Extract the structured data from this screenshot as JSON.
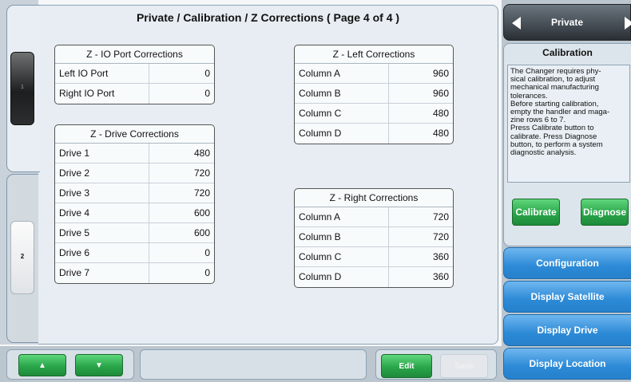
{
  "page": {
    "title": "Private / Calibration / Z Corrections ( Page 4 of 4 )"
  },
  "left_tabs": [
    {
      "label": "1"
    },
    {
      "label": "2"
    }
  ],
  "io_port": {
    "title": "Z - IO Port Corrections",
    "rows": [
      {
        "label": "Left IO Port",
        "value": "0"
      },
      {
        "label": "Right IO Port",
        "value": "0"
      }
    ]
  },
  "drive": {
    "title": "Z - Drive Corrections",
    "rows": [
      {
        "label": "Drive 1",
        "value": "480"
      },
      {
        "label": "Drive 2",
        "value": "720"
      },
      {
        "label": "Drive 3",
        "value": "720"
      },
      {
        "label": "Drive 4",
        "value": "600"
      },
      {
        "label": "Drive 5",
        "value": "600"
      },
      {
        "label": "Drive 6",
        "value": "0"
      },
      {
        "label": "Drive 7",
        "value": "0"
      }
    ]
  },
  "left_corr": {
    "title": "Z - Left Corrections",
    "rows": [
      {
        "label": "Column A",
        "value": "960"
      },
      {
        "label": "Column B",
        "value": "960"
      },
      {
        "label": "Column C",
        "value": "480"
      },
      {
        "label": "Column D",
        "value": "480"
      }
    ]
  },
  "right_corr": {
    "title": "Z - Right Corrections",
    "rows": [
      {
        "label": "Column A",
        "value": "720"
      },
      {
        "label": "Column B",
        "value": "720"
      },
      {
        "label": "Column C",
        "value": "360"
      },
      {
        "label": "Column D",
        "value": "360"
      }
    ]
  },
  "bottom": {
    "up_label": "▲",
    "down_label": "▼",
    "edit_label": "Edit",
    "save_label": "Save"
  },
  "sidebar": {
    "header": "Private",
    "panel_title": "Calibration",
    "description": "   The Changer requires phy-\nsical calibration, to adjust\nmechanical manufacturing\ntolerances.\n   Before starting calibration,\nempty the handler and maga-\nzine rows 6 to 7.\n   Press Calibrate button to\ncalibrate.  Press Diagnose\nbutton, to perform a system\ndiagnostic analysis.",
    "calibrate_label": "Calibrate",
    "diagnose_label": "Diagnose",
    "nav": [
      {
        "label": "Configuration"
      },
      {
        "label": "Display Satellite"
      },
      {
        "label": "Display Drive"
      },
      {
        "label": "Display Location"
      }
    ]
  },
  "colors": {
    "accent_green": "#2aa64a",
    "accent_blue": "#2c8ad6",
    "header_dark": "#2a2f34"
  }
}
